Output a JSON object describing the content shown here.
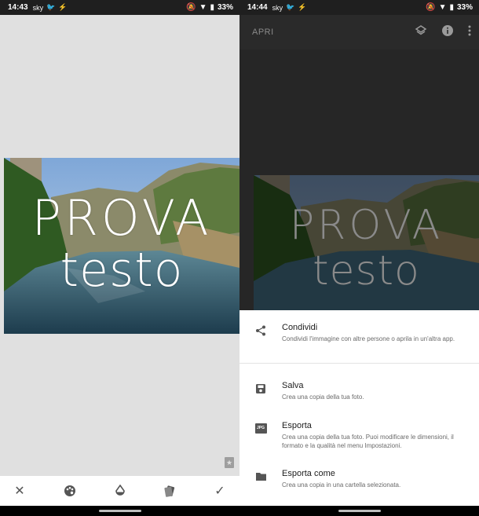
{
  "left": {
    "status": {
      "time": "14:43",
      "battery": "33%"
    },
    "overlay_text": {
      "line1": "PROVA",
      "line2": "testo"
    },
    "toolbar": {
      "close": "✕",
      "check": "✓"
    }
  },
  "right": {
    "status": {
      "time": "14:44",
      "battery": "33%"
    },
    "topbar": {
      "open_label": "APRI"
    },
    "overlay_text": {
      "line1": "PROVA",
      "line2": "testo"
    },
    "menu": [
      {
        "icon": "share-icon",
        "title": "Condividi",
        "desc": "Condividi l'immagine con altre persone o aprila in un'altra app."
      },
      {
        "icon": "save-icon",
        "title": "Salva",
        "desc": "Crea una copia della tua foto."
      },
      {
        "icon": "jpg-icon",
        "title": "Esporta",
        "desc": "Crea una copia della tua foto. Puoi modificare le dimensioni, il formato e la qualità nel menu Impostazioni."
      },
      {
        "icon": "folder-icon",
        "title": "Esporta come",
        "desc": "Crea una copia in una cartella selezionata."
      }
    ]
  },
  "colors": {
    "statusbar": "#1f1f1f",
    "left_bg": "#e0e0e0",
    "dim_bg": "#262626",
    "sheet": "#ffffff"
  }
}
